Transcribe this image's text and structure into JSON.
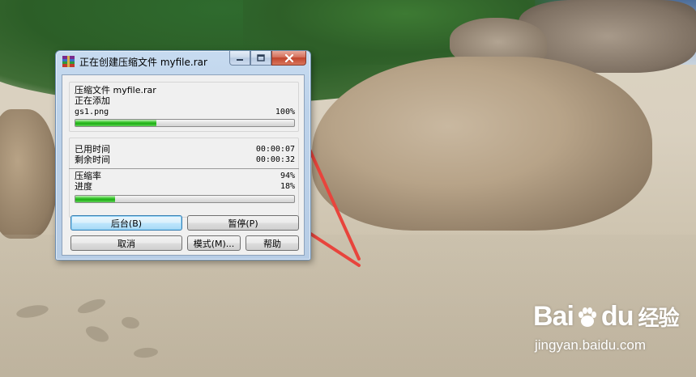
{
  "window": {
    "title": "正在创建压缩文件 myfile.rar",
    "app_icon": "winrar-books-icon"
  },
  "info": {
    "archive_label": "压缩文件 myfile.rar",
    "action_label": "正在添加",
    "current_file": "gs1.png",
    "file_percent": "100%",
    "file_progress": 0.37
  },
  "stats": {
    "elapsed_label": "已用时间",
    "elapsed_value": "00:00:07",
    "remaining_label": "剩余时间",
    "remaining_value": "00:00:32",
    "ratio_label": "压缩率",
    "ratio_value": "94%",
    "progress_label": "进度",
    "progress_value": "18%",
    "total_progress": 0.18
  },
  "buttons": {
    "background": "后台(B)",
    "pause": "暂停(P)",
    "cancel": "取消",
    "mode": "模式(M)...",
    "help": "帮助"
  },
  "watermark": {
    "logo_text_left": "Bai",
    "logo_text_right": "du",
    "logo_suffix": "经验",
    "url": "jingyan.baidu.com"
  },
  "colors": {
    "progress_green": "#1fae17",
    "arrow_red": "#e8443c",
    "close_red": "#c1442c"
  }
}
